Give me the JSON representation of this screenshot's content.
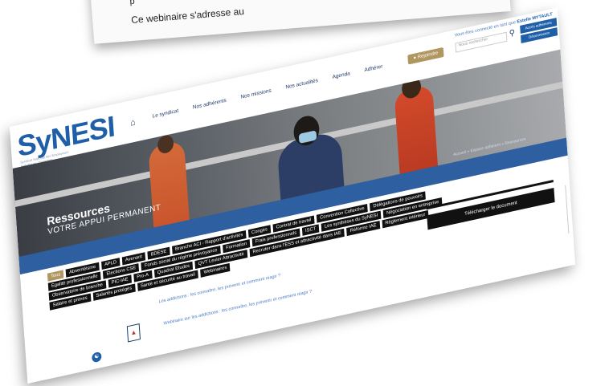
{
  "background_page": {
    "line1": "p",
    "line2": "Ce webinaire s'adresse au"
  },
  "header": {
    "logo": "SyNESI",
    "logo_tagline": "Syndicat National des Employeurs Spécifiques d'Insertion",
    "nav": [
      "Le syndicat",
      "Nos adhérents",
      "Nos missions",
      "Nos actualités",
      "Agenda",
      "Adhérer"
    ],
    "join_label": "Rejoindre",
    "contact_prefix": "Vous êtes connecté en tant que",
    "contact_name": "Estelle MYTAULT",
    "search_placeholder": "Nous rechercher",
    "member_area": "Accès adhérents",
    "logout": "Déconnexion"
  },
  "hero": {
    "title": "Ressources",
    "subtitle": "VOTRE APPUI PERMANENT",
    "breadcrumb": "Accueil » Espace adhérent » Ressources"
  },
  "filters": {
    "tags": [
      "Tous",
      "Absentéisme",
      "APLD",
      "Avenant",
      "BDESE",
      "Branche ACI - Rapport d'activités",
      "Congés",
      "Contrat de travail",
      "Convention Collective",
      "Délégations de pouvoirs",
      "Egalité professionnelle",
      "Elections CSE",
      "Fonds social du régime prévoyance",
      "Formation",
      "Frais professionnels",
      "ISCT",
      "Les synthèses du SyNESI",
      "Négociation en entreprise",
      "Observatoire de branche",
      "PIC-IAE",
      "Pro-A",
      "Quadrat Etudes",
      "QVT Levier Attractivité",
      "Recruter dans l'ESS et attractivité dans IAE",
      "Réforme IAE",
      "Règlement intérieur",
      "Salaire et primes",
      "Salariés protégés",
      "Santé et sécurité au travail",
      "Webinaires"
    ],
    "active_index": 0
  },
  "download": {
    "label": "Télécharger le document"
  },
  "content": {
    "question_link": "Les addictions : les connaître, les prévenir et comment réagir ?",
    "doc_link": "Webinaire sur les addictions : les connaître, les prévenir et comment réagir ?"
  }
}
